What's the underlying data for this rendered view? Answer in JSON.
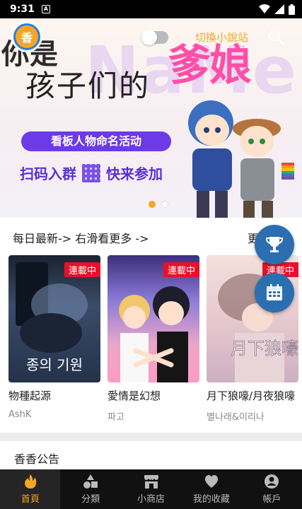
{
  "status_bar": {
    "time": "9:31",
    "a_badge": "A"
  },
  "header": {
    "logo_text": "香",
    "switch_label": "切換小說站"
  },
  "banner": {
    "headline_line1": "你是",
    "headline_line2": "孩子们的",
    "headline_pink": "爹娘",
    "activity": "看板人物命名活动",
    "scan_text": "扫码入群",
    "join_text": "快来参加"
  },
  "daily": {
    "title": "每日最新-> 右滑看更多 ->",
    "more": "更"
  },
  "cards": [
    {
      "tag": "連載中",
      "title": "物種起源",
      "author": "AshK",
      "cover_text": "종의 기원"
    },
    {
      "tag": "連載中",
      "title": "愛情是幻想",
      "author": "파고"
    },
    {
      "tag": "連載中",
      "title": "月下狼嚎/月夜狼嚎",
      "author": "별나래&이리나",
      "cover_text": "月下狼嚎"
    }
  ],
  "announcement": {
    "label": "香香公告"
  },
  "nav": [
    {
      "label": "首頁",
      "icon": "flame-icon",
      "active": true
    },
    {
      "label": "分類",
      "icon": "shapes-icon"
    },
    {
      "label": "小商店",
      "icon": "store-icon"
    },
    {
      "label": "我的收藏",
      "icon": "heart-icon"
    },
    {
      "label": "帳戶",
      "icon": "user-icon"
    }
  ],
  "colors": {
    "accent": "#f5a623",
    "fab": "#2c6fb0",
    "tag": "#e8102a",
    "banner_purple": "#6c3ae6"
  }
}
